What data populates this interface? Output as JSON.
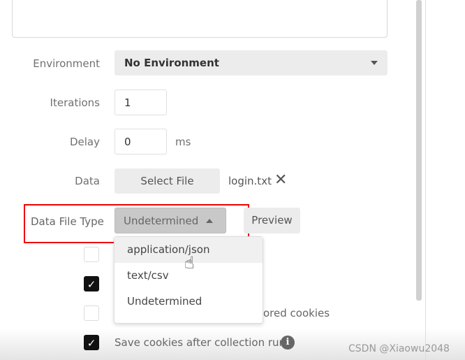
{
  "environment": {
    "label": "Environment",
    "value": "No Environment"
  },
  "iterations": {
    "label": "Iterations",
    "value": "1"
  },
  "delay": {
    "label": "Delay",
    "value": "0",
    "unit": "ms"
  },
  "data": {
    "label": "Data",
    "button": "Select File",
    "filename": "login.txt"
  },
  "data_file_type": {
    "label": "Data File Type",
    "value": "Undetermined",
    "preview": "Preview",
    "options": [
      "application/json",
      "text/csv",
      "Undetermined"
    ]
  },
  "options": [
    {
      "label": "",
      "checked": false
    },
    {
      "label": "",
      "checked": true
    },
    {
      "label": "ored cookies",
      "checked": false
    },
    {
      "label": "Save cookies after collection run",
      "checked": true
    }
  ],
  "watermark": "CSDN @Xiaowu2048"
}
